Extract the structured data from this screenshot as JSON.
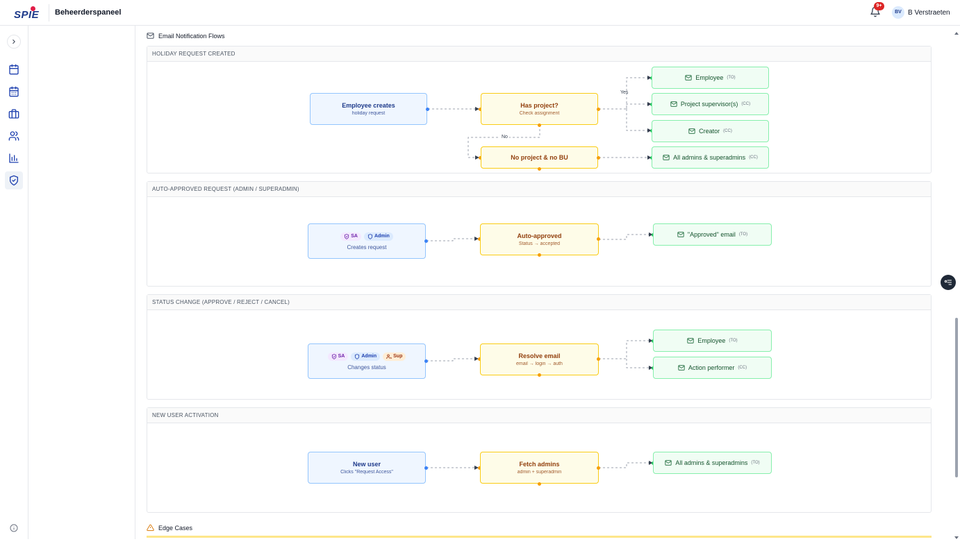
{
  "header": {
    "logo_text": "SPIE",
    "app_title": "Beheerderspaneel",
    "notification_count": "9+",
    "user_initials": "BV",
    "user_name": "B Verstraeten"
  },
  "sidebar": {
    "items": [
      {
        "icon": "calendar-icon"
      },
      {
        "icon": "calendar-days-icon"
      },
      {
        "icon": "briefcase-icon"
      },
      {
        "icon": "users-icon"
      },
      {
        "icon": "bar-chart-icon"
      },
      {
        "icon": "shield-check-icon",
        "active": true
      }
    ]
  },
  "section": {
    "title": "Email Notification Flows"
  },
  "flows": [
    {
      "title": "HOLIDAY REQUEST CREATED",
      "source": {
        "title": "Employee creates",
        "sub": "holiday request"
      },
      "decision": {
        "title": "Has project?",
        "sub": "Check assignment"
      },
      "fallback": {
        "title": "No project & no BU"
      },
      "label_yes": "Yes",
      "label_no": "No",
      "targets": [
        {
          "title": "Employee",
          "tag": "(TO)"
        },
        {
          "title": "Project supervisor(s)",
          "tag": "(CC)"
        },
        {
          "title": "Creator",
          "tag": "(CC)"
        },
        {
          "title": "All admins & superadmins",
          "tag": "(CC)"
        }
      ]
    },
    {
      "title": "AUTO-APPROVED REQUEST (ADMIN / SUPERADMIN)",
      "source": {
        "title": "Creates request",
        "pills": [
          "SA",
          "Admin"
        ]
      },
      "decision": {
        "title": "Auto-approved",
        "sub": "Status → accepted"
      },
      "targets": [
        {
          "title": "\"Approved\" email",
          "tag": "(TO)"
        }
      ]
    },
    {
      "title": "STATUS CHANGE (APPROVE / REJECT / CANCEL)",
      "source": {
        "title": "Changes status",
        "pills": [
          "SA",
          "Admin",
          "Sup"
        ]
      },
      "decision": {
        "title": "Resolve email",
        "sub": "email → login → auth"
      },
      "targets": [
        {
          "title": "Employee",
          "tag": "(TO)"
        },
        {
          "title": "Action performer",
          "tag": "(CC)"
        }
      ]
    },
    {
      "title": "NEW USER ACTIVATION",
      "source": {
        "title": "New user",
        "sub": "Clicks \"Request Access\""
      },
      "decision": {
        "title": "Fetch admins",
        "sub": "admin + superadmin"
      },
      "targets": [
        {
          "title": "All admins & superadmins",
          "tag": "(TO)"
        }
      ]
    }
  ],
  "edge_cases": {
    "title": "Edge Cases"
  },
  "colors": {
    "source_bg": "#eff6ff",
    "source_border": "#93c5fd",
    "process_bg": "#fefce8",
    "process_border": "#facc15",
    "target_bg": "#f0fdf4",
    "target_border": "#86efac",
    "badge": "#dc2626",
    "brand": "#1e3a8a"
  }
}
